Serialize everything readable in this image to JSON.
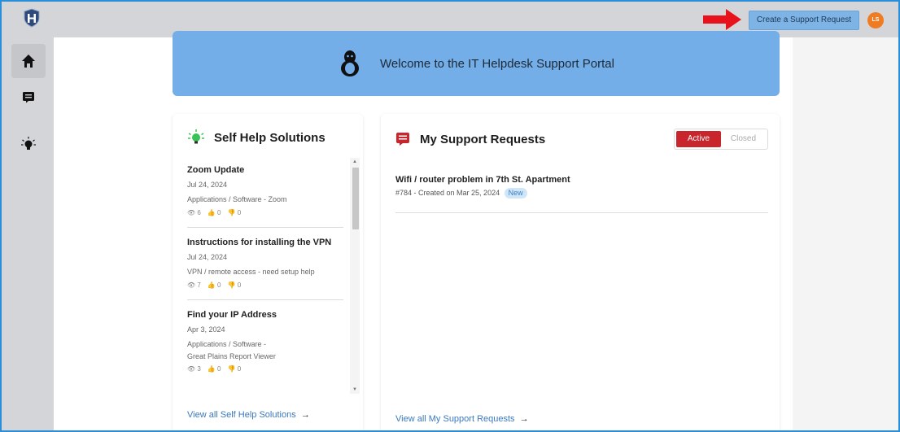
{
  "header": {
    "create_request_label": "Create a Support Request",
    "avatar_initials": "LS"
  },
  "sidebar": {
    "items": [
      {
        "name": "home",
        "icon": "home-icon"
      },
      {
        "name": "requests",
        "icon": "ticket-icon"
      },
      {
        "name": "self-help",
        "icon": "lightbulb-icon"
      }
    ]
  },
  "banner": {
    "text": "Welcome to the IT Helpdesk Support Portal",
    "icon": "linux-penguin-icon"
  },
  "self_help": {
    "title": "Self Help Solutions",
    "items": [
      {
        "title": "Zoom Update",
        "date": "Jul 24, 2024",
        "category": "Applications / Software - Zoom",
        "category2": "",
        "views": "6",
        "likes": "0",
        "dislikes": "0"
      },
      {
        "title": "Instructions for installing the VPN",
        "date": "Jul 24, 2024",
        "category": "VPN / remote access - need setup help",
        "category2": "",
        "views": "7",
        "likes": "0",
        "dislikes": "0"
      },
      {
        "title": "Find your IP Address",
        "date": "Apr 3, 2024",
        "category": "Applications / Software -",
        "category2": "Great Plains Report Viewer",
        "views": "3",
        "likes": "0",
        "dislikes": "0"
      }
    ],
    "view_all": "View all Self Help Solutions"
  },
  "support_requests": {
    "title": "My Support Requests",
    "toggle_active": "Active",
    "toggle_closed": "Closed",
    "items": [
      {
        "title": "Wifi / router problem in 7th St. Apartment",
        "meta": "#784 - Created on Mar 25, 2024",
        "status": "New"
      }
    ],
    "view_all": "View all My Support Requests"
  },
  "colors": {
    "accent_red": "#c8252c",
    "banner_blue": "#73aee9",
    "button_blue": "#7eb3e6",
    "avatar_orange": "#f07c22"
  }
}
